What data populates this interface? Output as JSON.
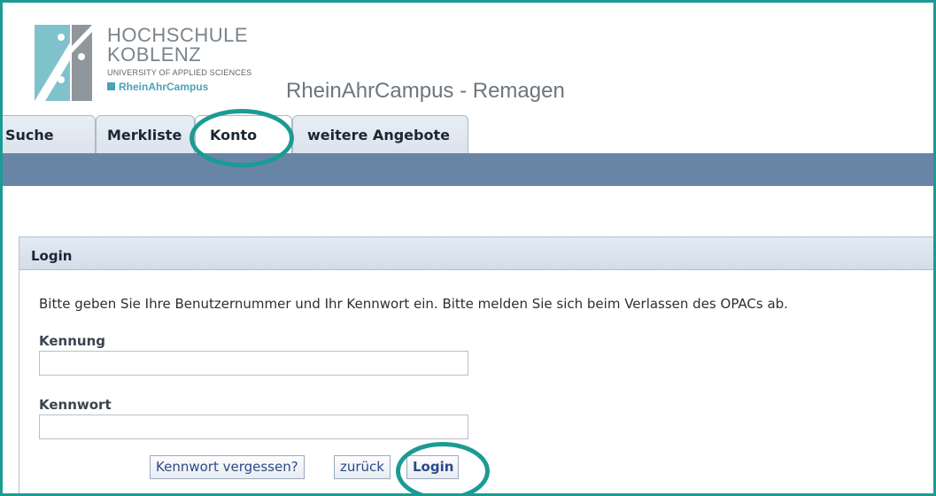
{
  "header": {
    "brand": {
      "line1": "HOCHSCHULE",
      "line2": "KOBLENZ",
      "line3": "UNIVERSITY OF APPLIED SCIENCES",
      "line4": "RheinAhrCampus"
    },
    "campus_title": "RheinAhrCampus - Remagen"
  },
  "tabs": [
    {
      "label": "Suche"
    },
    {
      "label": "Merkliste"
    },
    {
      "label": "Konto"
    },
    {
      "label": "weitere Angebote"
    }
  ],
  "login": {
    "title": "Login",
    "intro": "Bitte geben Sie Ihre Benutzernummer und Ihr Kennwort ein. Bitte melden Sie sich beim Verlassen des OPACs ab.",
    "user_label": "Kennung",
    "user_value": "",
    "password_label": "Kennwort",
    "password_value": "",
    "forgot_label": "Kennwort vergessen?",
    "back_label": "zurück",
    "submit_label": "Login"
  },
  "colors": {
    "highlight": "#1a9b93",
    "bar": "#6985a6",
    "logo_teal": "#4aa3b8"
  }
}
